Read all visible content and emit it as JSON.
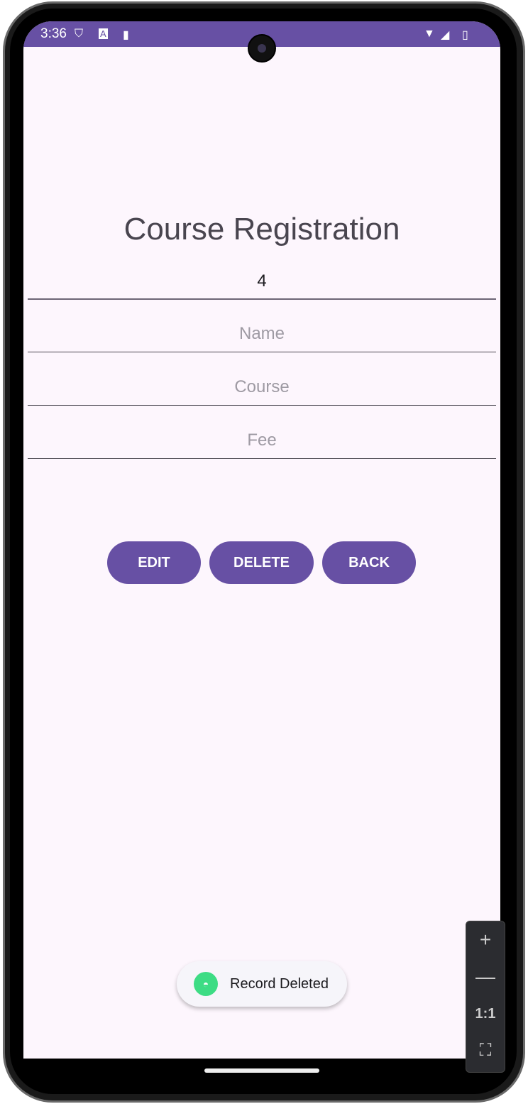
{
  "status_bar": {
    "time": "3:36",
    "icons": [
      "shield-icon",
      "a-icon",
      "sd-card-icon",
      "wifi-icon",
      "signal-icon",
      "battery-icon"
    ],
    "color": "#6750a4"
  },
  "page": {
    "title": "Course Registration"
  },
  "form": {
    "id_value": "4",
    "name_placeholder": "Name",
    "course_placeholder": "Course",
    "fee_placeholder": "Fee"
  },
  "buttons": {
    "edit": "EDIT",
    "delete": "DELETE",
    "back": "BACK"
  },
  "toast": {
    "message": "Record Deleted"
  },
  "emulator_zoom": {
    "zoom_in": "+",
    "zoom_out": "—",
    "actual_size": "1:1"
  }
}
